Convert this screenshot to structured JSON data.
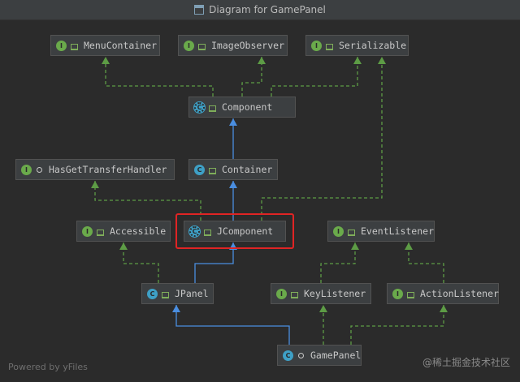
{
  "window": {
    "title": "Diagram for GamePanel"
  },
  "nodes": [
    {
      "id": "menu",
      "name": "MenuContainer",
      "kind": "interface",
      "badge": "I",
      "visibility": "lock"
    },
    {
      "id": "imgobs",
      "name": "ImageObserver",
      "kind": "interface",
      "badge": "I",
      "visibility": "lock"
    },
    {
      "id": "serial",
      "name": "Serializable",
      "kind": "interface",
      "badge": "I",
      "visibility": "lock"
    },
    {
      "id": "component",
      "name": "Component",
      "kind": "abstract",
      "badge": "C",
      "visibility": "lock"
    },
    {
      "id": "hasget",
      "name": "HasGetTransferHandler",
      "kind": "interface",
      "badge": "I",
      "visibility": "circle"
    },
    {
      "id": "container",
      "name": "Container",
      "kind": "class",
      "badge": "C",
      "visibility": "lock"
    },
    {
      "id": "accessible",
      "name": "Accessible",
      "kind": "interface",
      "badge": "I",
      "visibility": "lock"
    },
    {
      "id": "jcomponent",
      "name": "JComponent",
      "kind": "abstract",
      "badge": "C",
      "visibility": "lock"
    },
    {
      "id": "evlistener",
      "name": "EventListener",
      "kind": "interface",
      "badge": "I",
      "visibility": "lock"
    },
    {
      "id": "jpanel",
      "name": "JPanel",
      "kind": "class",
      "badge": "C",
      "visibility": "lock"
    },
    {
      "id": "keylistener",
      "name": "KeyListener",
      "kind": "interface",
      "badge": "I",
      "visibility": "lock"
    },
    {
      "id": "actlistener",
      "name": "ActionListener",
      "kind": "interface",
      "badge": "I",
      "visibility": "lock"
    },
    {
      "id": "gamepanel",
      "name": "GamePanel",
      "kind": "class",
      "badge": "C",
      "visibility": "circle"
    }
  ],
  "edges": [
    {
      "from": "component",
      "to": "menu",
      "type": "implements"
    },
    {
      "from": "component",
      "to": "imgobs",
      "type": "implements"
    },
    {
      "from": "component",
      "to": "serial",
      "type": "implements"
    },
    {
      "from": "container",
      "to": "component",
      "type": "extends"
    },
    {
      "from": "jcomponent",
      "to": "hasget",
      "type": "implements"
    },
    {
      "from": "jcomponent",
      "to": "container",
      "type": "extends"
    },
    {
      "from": "jcomponent",
      "to": "serial",
      "type": "implements"
    },
    {
      "from": "jpanel",
      "to": "accessible",
      "type": "implements"
    },
    {
      "from": "jpanel",
      "to": "jcomponent",
      "type": "extends"
    },
    {
      "from": "keylistener",
      "to": "evlistener",
      "type": "extends-interface"
    },
    {
      "from": "actlistener",
      "to": "evlistener",
      "type": "extends-interface"
    },
    {
      "from": "gamepanel",
      "to": "jpanel",
      "type": "extends"
    },
    {
      "from": "gamepanel",
      "to": "keylistener",
      "type": "implements"
    },
    {
      "from": "gamepanel",
      "to": "actlistener",
      "type": "implements"
    }
  ],
  "highlighted": "jcomponent",
  "colors": {
    "extends": "#4a8ee0",
    "implements": "#5d9c45",
    "highlight": "#e02424"
  },
  "footer": "Powered by yFiles",
  "watermark": "@稀土掘金技术社区"
}
